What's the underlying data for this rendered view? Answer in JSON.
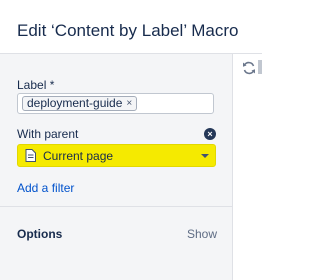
{
  "dialog": {
    "title": "Edit ‘Content by Label’ Macro"
  },
  "label_field": {
    "label": "Label *",
    "tags": [
      {
        "text": "deployment-guide",
        "remove": "×"
      }
    ]
  },
  "parent_field": {
    "label": "With parent",
    "clear_symbol": "×",
    "selected_value": "Current page",
    "highlight_color": "#f5ea00"
  },
  "add_filter": {
    "label": "Add a filter"
  },
  "options": {
    "label": "Options",
    "show_label": "Show"
  }
}
